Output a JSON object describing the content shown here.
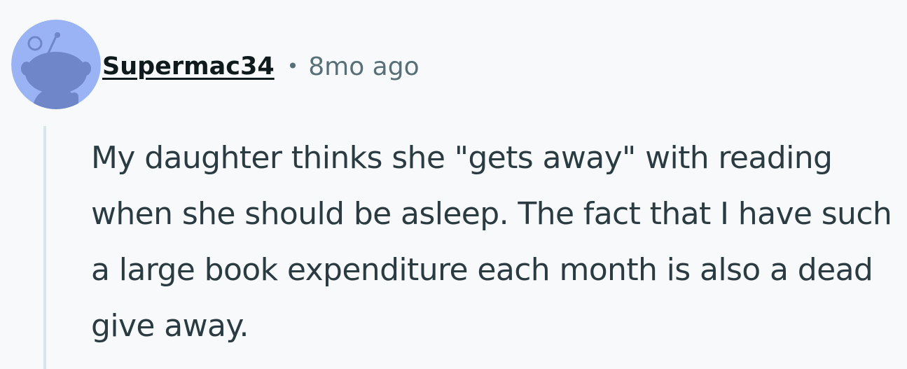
{
  "comment": {
    "author": "Supermac34",
    "separator": "•",
    "age": "8mo ago",
    "body": "My daughter thinks she \"gets away\" with reading when she should be asleep. The fact that I have such a large book expenditure each month is also a dead give away.",
    "avatar_icon": "snoo-avatar-icon"
  },
  "colors": {
    "background": "#f7f9fa",
    "avatar_bg": "#9ab3f5",
    "avatar_figure": "#6f86c8",
    "text": "#2a3c42",
    "meta_text": "#576f76",
    "thread_line": "#dbe4e8"
  }
}
